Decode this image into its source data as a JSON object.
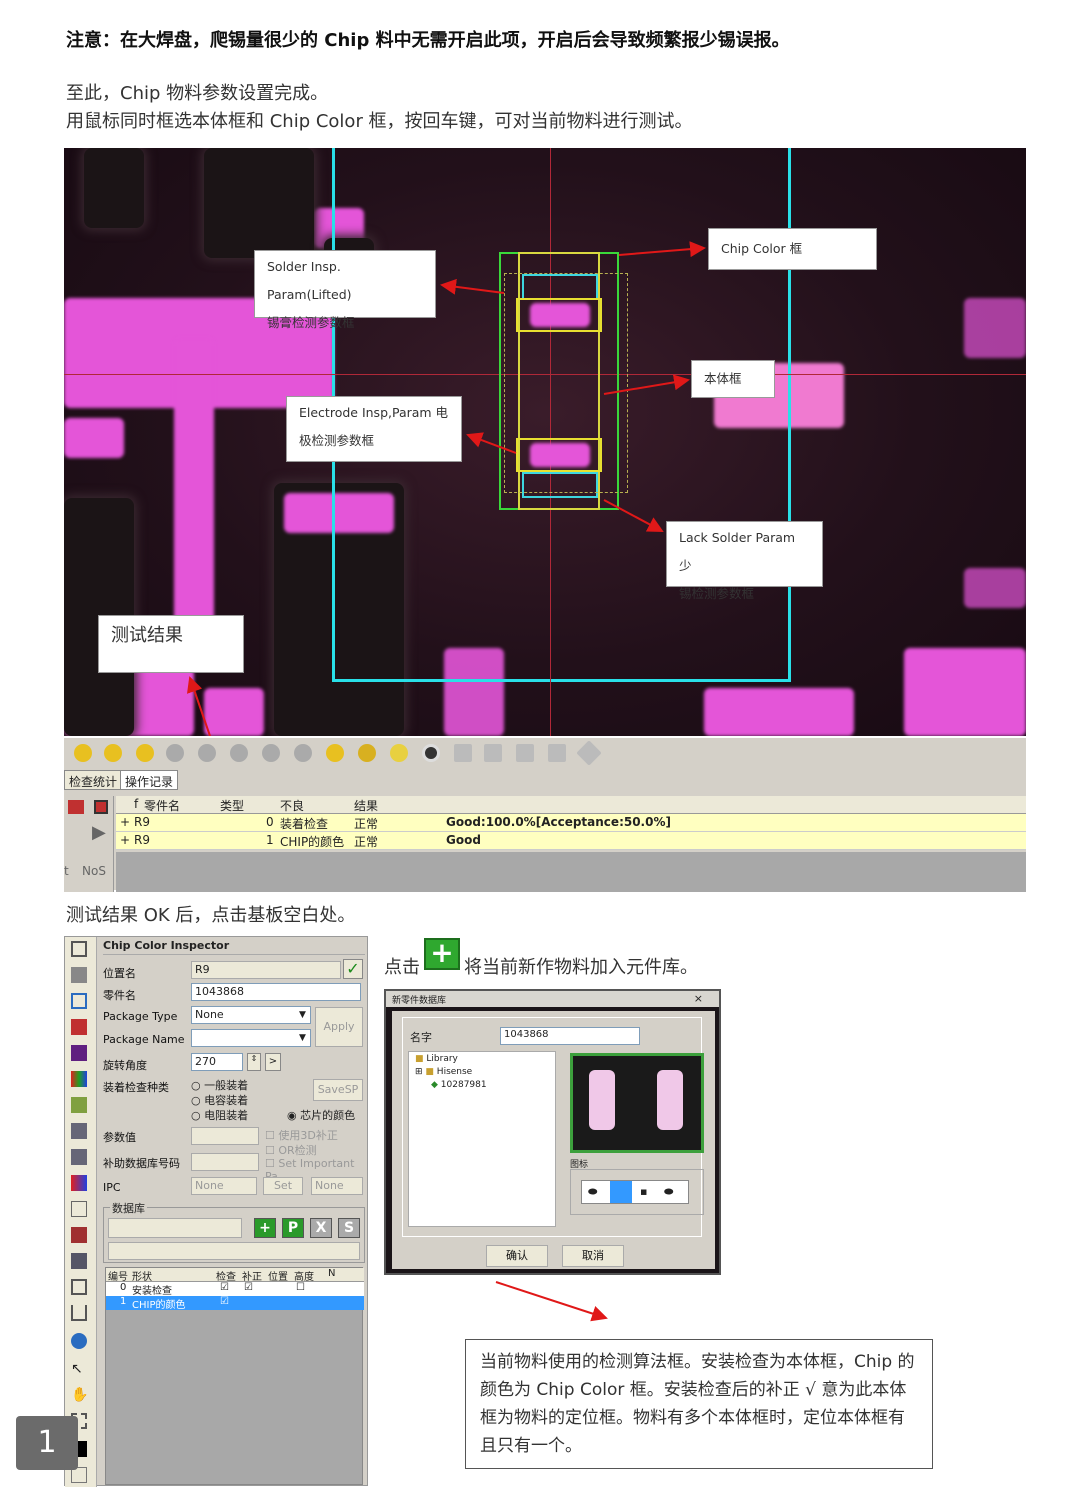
{
  "intro": {
    "note": "注意：在大焊盘，爬锡量很少的 Chip 料中无需开启此项，开启后会导致频繁报少锡误报。",
    "line1": "至此，Chip 物料参数设置完成。",
    "line2": "用鼠标同时框选本体框和 Chip Color 框，按回车键，可对当前物料进行测试。"
  },
  "camera": {
    "callouts": {
      "solder_a": "Solder  Insp.  Param(Lifted)",
      "solder_b": "锡膏检测参数框",
      "chipcolor": "Chip Color 框",
      "body": "本体框",
      "electrode_a": "Electrode  Insp,Param  电",
      "electrode_b": "极检测参数框",
      "lack_a": "Lack Solder Param  少",
      "lack_b": "锡检测参数框",
      "result": "测试结果"
    }
  },
  "strip": {
    "tabs": [
      "检查统计",
      "操作记录"
    ],
    "columns": [
      "f",
      "零件名",
      "类型",
      "不良",
      "结果"
    ],
    "rows": [
      {
        "expander": "+",
        "name": "R9",
        "index": "0",
        "type": "装着检查",
        "status": "正常",
        "result": "Good:100.0%[Acceptance:50.0%]"
      },
      {
        "expander": "+",
        "name": "R9",
        "index": "1",
        "type": "CHIP的颜色",
        "status": "正常",
        "result": "Good"
      }
    ],
    "side_labels": [
      "t",
      "NoS"
    ]
  },
  "after_test": "测试结果 OK 后，点击基板空白处。",
  "inspector": {
    "title": "Chip Color Inspector",
    "fields": {
      "pos_label": "位置名",
      "pos_value": "R9",
      "part_label": "零件名",
      "part_value": "1043868",
      "pkgtype_label": "Package Type",
      "pkgtype_value": "None",
      "pkgname_label": "Package Name",
      "pkgname_value": "",
      "rot_label": "旋转角度",
      "rot_value": "270",
      "kind_label": "装着检查种类",
      "param_label": "参数值",
      "aux_label": "补助数据库号码",
      "ipc_label": "IPC",
      "ipc_value": "None",
      "ipc_value2": "None"
    },
    "buttons": {
      "apply": "Apply",
      "savesp": "SaveSP",
      "set": "Set",
      "rot_arrow": ">"
    },
    "radios": [
      "一般装着",
      "电容装着",
      "电阻装着",
      "芯片的颜色"
    ],
    "checks": [
      "使用3D补正",
      "OR检测",
      "Set Important Pa"
    ],
    "db_label": "数据库",
    "db_buttons": [
      "+",
      "P",
      "X",
      "S"
    ],
    "table_head": [
      "编号",
      "形状",
      "检查",
      "补正",
      "位置",
      "高度",
      "N"
    ],
    "table_rows": [
      {
        "no": "0",
        "shape": "安装检查",
        "check": "☑",
        "correct": "☑",
        "pos": "",
        "height": "☐"
      },
      {
        "no": "1",
        "shape": "CHIP的颜色",
        "check": "☑",
        "correct": "",
        "pos": "",
        "height": ""
      }
    ]
  },
  "click_hint": {
    "before": "点击",
    "after": "将当前新作物料加入元件库。"
  },
  "dialog": {
    "title": "新零件数据库",
    "name_label": "名字",
    "name_value": "1043868",
    "tree": [
      "Library",
      "Hisense",
      "10287981"
    ],
    "icon_label": "图标",
    "ok": "确认",
    "cancel": "取消"
  },
  "explain": "当前物料使用的检测算法框。安装检查为本体框，Chip 的颜色为 Chip Color 框。安装检查后的补正 √ 意为此本体框为物料的定位框。物料有多个本体框时，定位本体框有且只有一个。",
  "page_number": "1"
}
